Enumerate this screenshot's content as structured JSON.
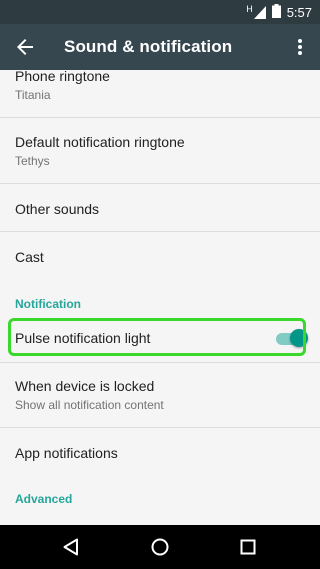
{
  "status_bar": {
    "network": "H",
    "time": "5:57",
    "icons": [
      "signal-icon",
      "battery-icon"
    ]
  },
  "app_bar": {
    "title": "Sound & notification",
    "icons": [
      "back-arrow-icon",
      "overflow-menu-icon"
    ]
  },
  "settings": {
    "phone_ringtone": {
      "title": "Phone ringtone",
      "summary": "Titania"
    },
    "default_notification_ringtone": {
      "title": "Default notification ringtone",
      "summary": "Tethys"
    },
    "other_sounds": {
      "title": "Other sounds"
    },
    "cast": {
      "title": "Cast"
    },
    "notification_header": "Notification",
    "pulse_light": {
      "title": "Pulse notification light",
      "enabled": true
    },
    "when_locked": {
      "title": "When device is locked",
      "summary": "Show all notification content"
    },
    "app_notifications": {
      "title": "App notifications"
    },
    "advanced_header": "Advanced"
  },
  "nav_bar": {
    "icons": [
      "back-triangle-icon",
      "home-circle-icon",
      "recents-square-icon"
    ]
  },
  "colors": {
    "status_bar": "#2e3b40",
    "app_bar": "#37474f",
    "accent": "#009688",
    "section_header": "#26a69a",
    "highlight": "#39d82a"
  }
}
